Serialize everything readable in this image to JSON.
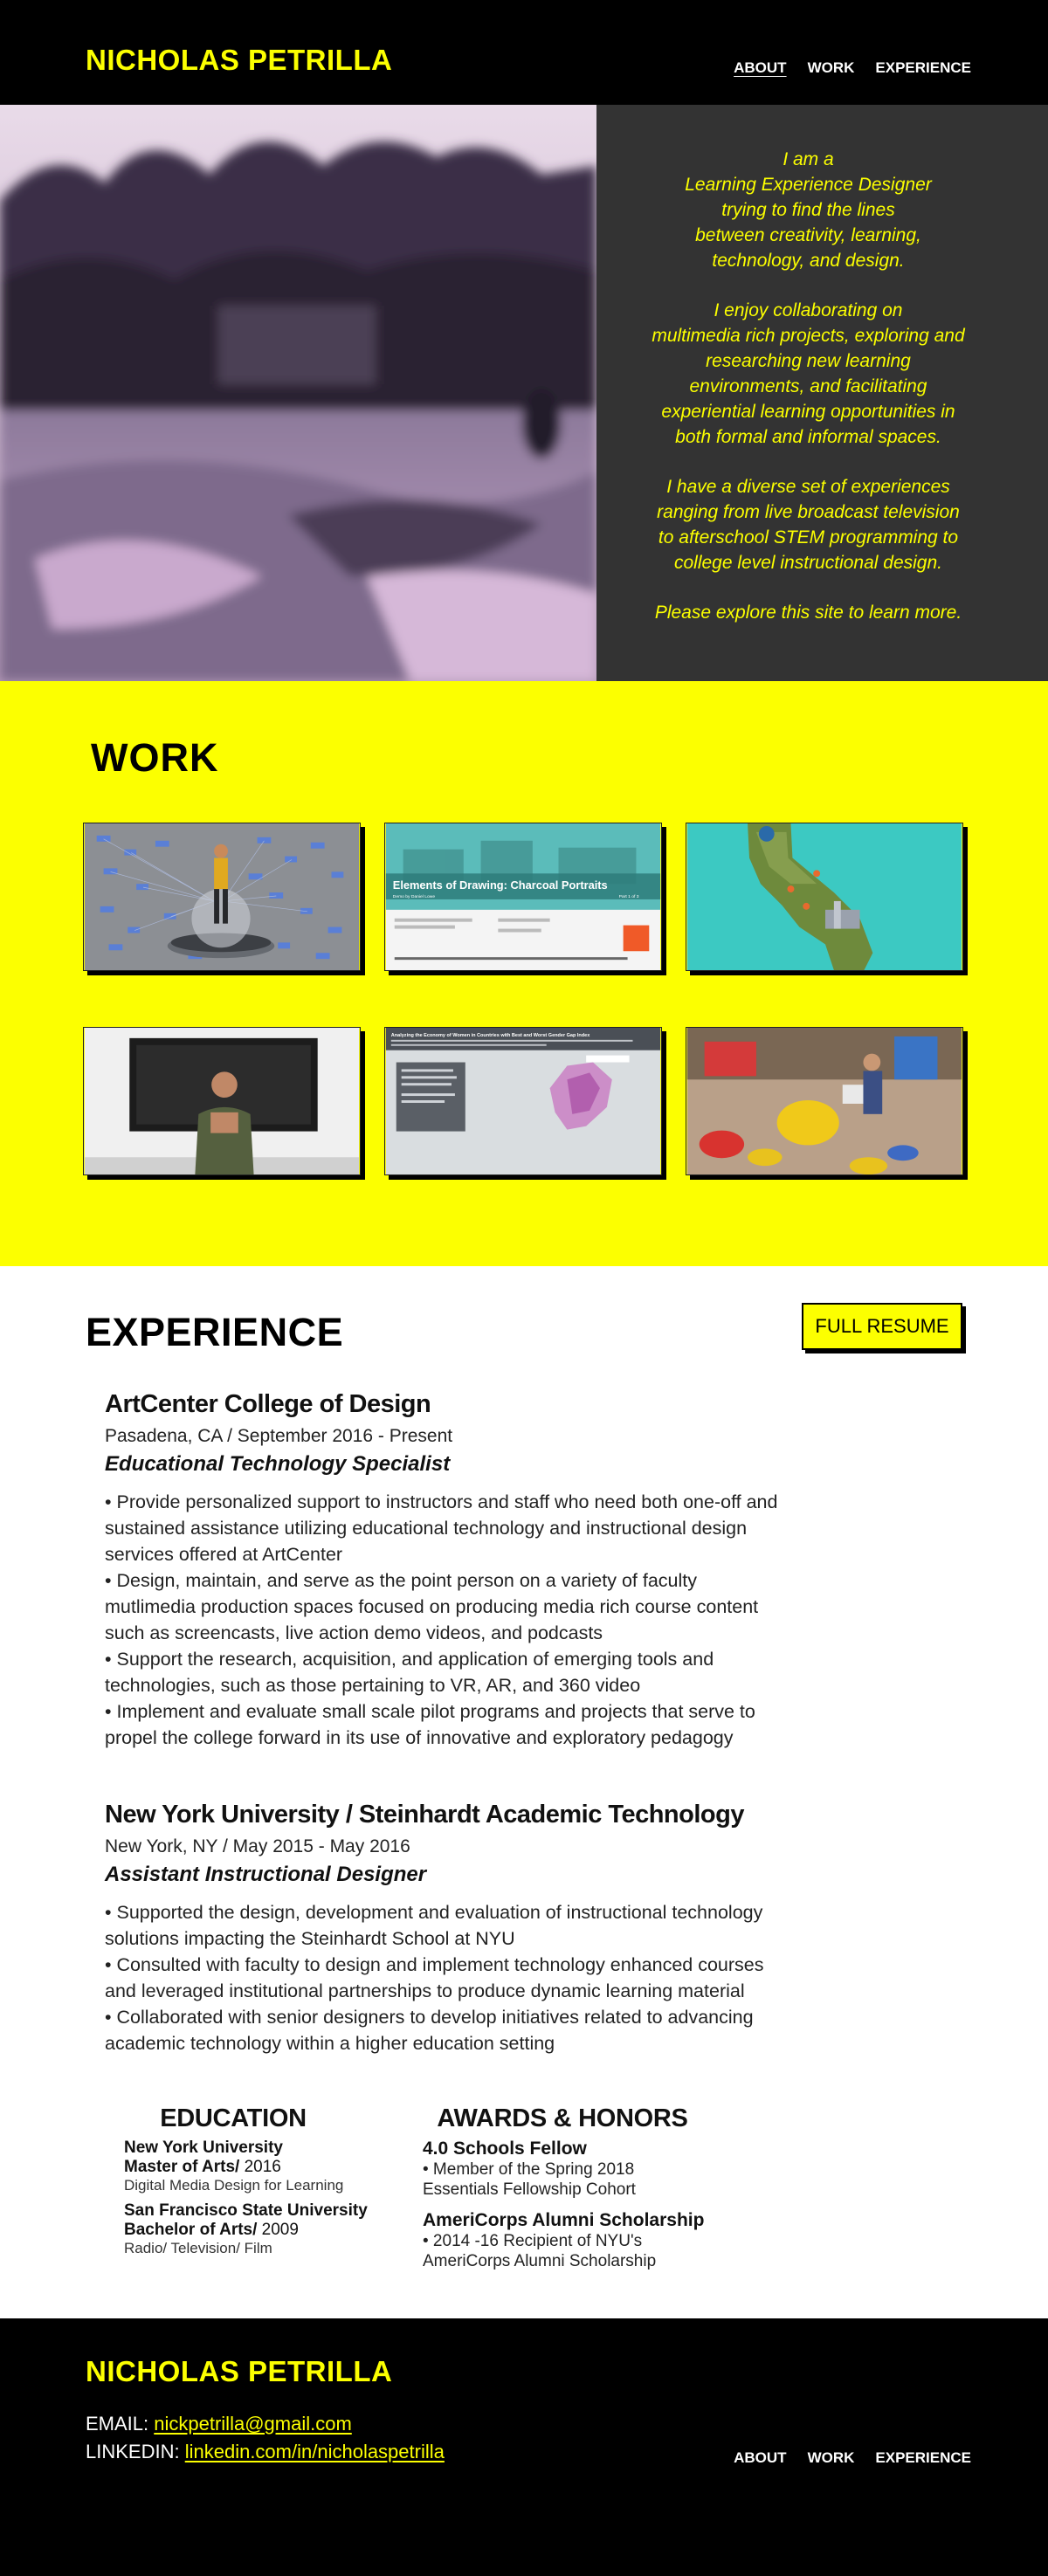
{
  "header": {
    "brand": "NICHOLAS PETRILLA",
    "nav": [
      {
        "label": "ABOUT"
      },
      {
        "label": "WORK"
      },
      {
        "label": "EXPERIENCE"
      }
    ]
  },
  "hero": {
    "paragraphs": [
      "I am a\nLearning Experience Designer\ntrying to find the lines\nbetween creativity, learning,\ntechnology, and design.",
      "I enjoy collaborating on\nmultimedia rich projects, exploring and\nresearching new learning\nenvironments, and facilitating\nexperiential learning opportunities in\nboth formal and informal spaces.",
      "I have a diverse set of experiences\nranging from live broadcast television\nto afterschool STEM programming to\ncollege level instructional design.",
      "Please explore this site to learn more."
    ]
  },
  "work": {
    "title": "WORK",
    "tiles": [
      {
        "icon": "trampoline-mindmap-thumbnail"
      },
      {
        "icon": "charcoal-portraits-thumbnail",
        "title": "Elements of Drawing: Charcoal Portraits",
        "subtitle": "Demo by Daniel Lowe",
        "part": "Part 1 of 3"
      },
      {
        "icon": "california-map-thumbnail"
      },
      {
        "icon": "presenter-video-thumbnail"
      },
      {
        "icon": "gender-gap-map-thumbnail",
        "header": "Analyzing the Economy of Women in Countries with Best and Worst Gender Gap Index"
      },
      {
        "icon": "playroom-thumbnail"
      }
    ]
  },
  "experience": {
    "title": "EXPERIENCE",
    "resume_label": "FULL RESUME",
    "jobs": [
      {
        "org": "ArtCenter College of Design",
        "meta": "Pasadena, CA / September 2016 - Present",
        "role": "Educational Technology Specialist",
        "bullets": [
          "• Provide personalized support to instructors and staff who need both one-off and",
          "sustained assistance utilizing educational technology and instructional design",
          "services offered at ArtCenter",
          "• Design, maintain, and serve as the point person on a variety of faculty",
          "mutlimedia production spaces focused on producing media rich course content",
          "such as screencasts, live action demo videos, and podcasts",
          "• Support the research, acquisition, and application of emerging tools and",
          "technologies, such as those pertaining to VR, AR, and 360 video",
          "• Implement and evaluate small scale pilot programs and projects that serve to",
          "propel the college forward in its use of innovative and exploratory pedagogy"
        ]
      },
      {
        "org": "New York University / Steinhardt Academic Technology",
        "meta": "New York, NY / May 2015 - May 2016",
        "role": "Assistant Instructional Designer",
        "bullets": [
          "• Supported the design, development and evaluation of instructional technology",
          "solutions impacting the Steinhardt School at NYU",
          "• Consulted with faculty to design and implement technology enhanced courses",
          "and leveraged institutional partnerships to produce dynamic learning material",
          "• Collaborated with senior designers to develop initiatives related to advancing",
          "academic technology within a higher education setting"
        ]
      }
    ],
    "education": {
      "title": "EDUCATION",
      "items": [
        {
          "school": "New York University",
          "degree": "Master of Arts/",
          "year": " 2016",
          "field": "Digital Media Design for Learning"
        },
        {
          "school": "San Francisco State University",
          "degree": "Bachelor of Arts/",
          "year": " 2009",
          "field": "Radio/ Television/ Film"
        }
      ]
    },
    "awards": {
      "title": "AWARDS & HONORS",
      "items": [
        {
          "name": "4.0 Schools Fellow",
          "lines": [
            "• Member of the Spring 2018",
            "Essentials Fellowship Cohort"
          ]
        },
        {
          "name": "AmeriCorps Alumni Scholarship",
          "lines": [
            "• 2014 -16 Recipient of NYU's",
            "AmeriCorps Alumni Scholarship"
          ]
        }
      ]
    }
  },
  "footer": {
    "brand": "NICHOLAS PETRILLA",
    "email_label": "EMAIL:",
    "email": "nickpetrilla@gmail.com",
    "linkedin_label": "LINKEDIN:",
    "linkedin": "linkedin.com/in/nicholaspetrilla",
    "nav": [
      {
        "label": "ABOUT"
      },
      {
        "label": "WORK"
      },
      {
        "label": "EXPERIENCE"
      }
    ]
  },
  "colors": {
    "accent": "#fcff00",
    "dark": "#000000",
    "hero_panel": "#333333"
  }
}
